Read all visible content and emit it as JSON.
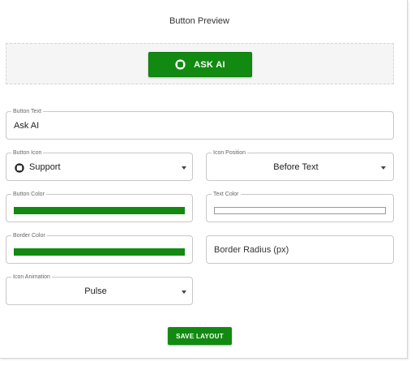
{
  "preview": {
    "title": "Button Preview",
    "button_label": "ASK AI",
    "button_icon": "support-icon"
  },
  "form": {
    "button_text": {
      "label": "Button Text",
      "value": "Ask AI"
    },
    "button_icon": {
      "label": "Button Icon",
      "value": "Support",
      "icon": "support-icon"
    },
    "icon_position": {
      "label": "Icon Position",
      "value": "Before Text"
    },
    "button_color": {
      "label": "Button Color",
      "value": "#128a12"
    },
    "text_color": {
      "label": "Text Color",
      "value": "#ffffff"
    },
    "border_color": {
      "label": "Border Color",
      "value": "#128a12"
    },
    "border_radius": {
      "placeholder": "Border Radius (px)"
    },
    "icon_animation": {
      "label": "Icon Animation",
      "value": "Pulse"
    }
  },
  "actions": {
    "save_label": "SAVE LAYOUT"
  },
  "colors": {
    "accent": "#128a12",
    "field_border": "#c8c8c8",
    "preview_bg": "#f5f5f5"
  }
}
